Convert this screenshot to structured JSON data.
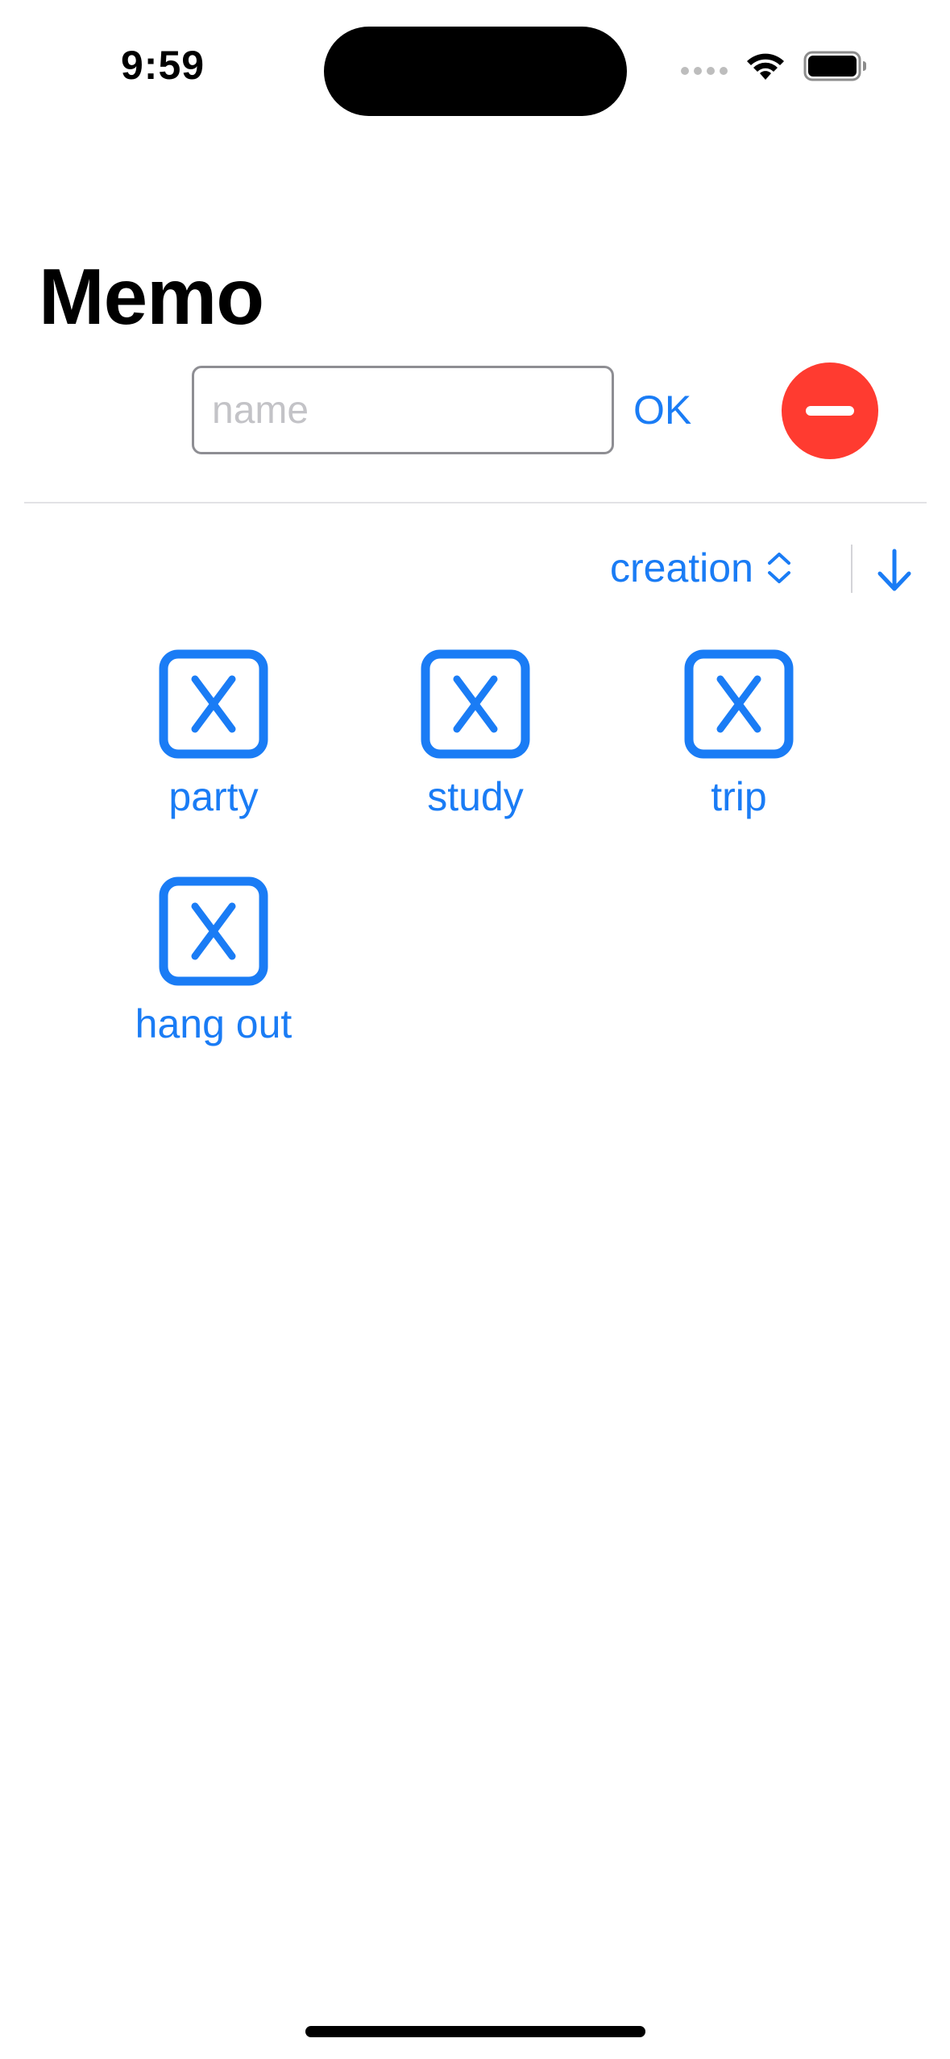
{
  "status_bar": {
    "time": "9:59",
    "icons": [
      "cellular-signal-icon",
      "wifi-icon",
      "battery-icon"
    ]
  },
  "header": {
    "title": "Memo"
  },
  "input_row": {
    "placeholder": "name",
    "value": "",
    "ok_label": "OK",
    "remove_icon": "minus-circle-icon"
  },
  "sort": {
    "selected": "creation",
    "picker_icon": "chevron-up-down-icon",
    "order_icon": "arrow-down-icon"
  },
  "memos": [
    {
      "label": "party",
      "icon": "x-square-icon"
    },
    {
      "label": "study",
      "icon": "x-square-icon"
    },
    {
      "label": "trip",
      "icon": "x-square-icon"
    },
    {
      "label": "hang out",
      "icon": "x-square-icon"
    }
  ],
  "colors": {
    "accent": "#1a7cf5",
    "destructive": "#ff3b30",
    "text": "#000000",
    "placeholder": "#c3c3c7"
  }
}
